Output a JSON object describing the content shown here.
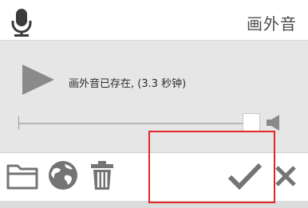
{
  "header": {
    "title": "画外音",
    "mic_icon": "microphone-icon"
  },
  "player": {
    "status_text": "画外音已存在, (3.3 秒钟)",
    "play_icon": "play-icon",
    "volume_icon": "volume-icon",
    "position_fraction": 0.97
  },
  "toolbar": {
    "icons": [
      "folder-icon",
      "globe-icon",
      "trash-icon",
      "checkmark-icon",
      "close-icon"
    ]
  },
  "colors": {
    "icon_gray": "#747474",
    "highlight": "#e02828",
    "body_bg": "#e6e6e6"
  }
}
